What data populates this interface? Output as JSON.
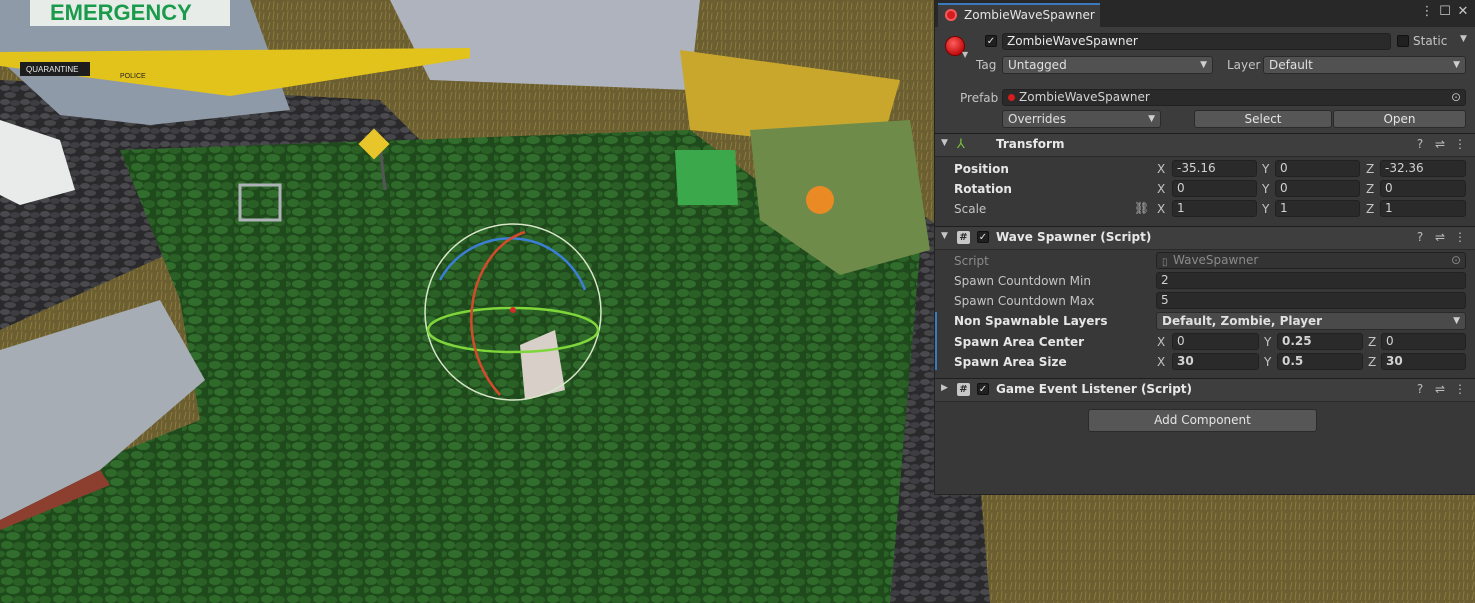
{
  "inspector": {
    "tab_title": "ZombieWaveSpawner",
    "object_name": "ZombieWaveSpawner",
    "active_checked": true,
    "static_label": "Static",
    "static_checked": false,
    "tag_label": "Tag",
    "tag_value": "Untagged",
    "layer_label": "Layer",
    "layer_value": "Default",
    "prefab_label": "Prefab",
    "prefab_value": "ZombieWaveSpawner",
    "overrides_label": "Overrides",
    "select_label": "Select",
    "open_label": "Open",
    "accent_color": "#3a79bb",
    "prefab_icon_color": "#d61c1c"
  },
  "transform": {
    "title": "Transform",
    "position_label": "Position",
    "rotation_label": "Rotation",
    "scale_label": "Scale",
    "axis_x": "X",
    "axis_y": "Y",
    "axis_z": "Z",
    "position": {
      "x": "-35.16",
      "y": "0",
      "z": "-32.36"
    },
    "rotation": {
      "x": "0",
      "y": "0",
      "z": "0"
    },
    "scale": {
      "x": "1",
      "y": "1",
      "z": "1"
    }
  },
  "wave_spawner": {
    "title": "Wave Spawner (Script)",
    "script_label": "Script",
    "script_value": "WaveSpawner",
    "countdown_min_label": "Spawn Countdown Min",
    "countdown_min_value": "2",
    "countdown_max_label": "Spawn Countdown Max",
    "countdown_max_value": "5",
    "non_spawnable_label": "Non Spawnable Layers",
    "non_spawnable_value": "Default, Zombie, Player",
    "area_center_label": "Spawn Area Center",
    "area_center": {
      "x": "0",
      "y": "0.25",
      "z": "0"
    },
    "area_size_label": "Spawn Area Size",
    "area_size": {
      "x": "30",
      "y": "0.5",
      "z": "30"
    }
  },
  "game_event_listener": {
    "title": "Game Event Listener (Script)"
  },
  "add_component_label": "Add Component",
  "scene": {
    "emergency_sign": "EMERGENCY",
    "quarantine_sign": "QUARANTINE",
    "police_tape_text": "POLICE"
  }
}
